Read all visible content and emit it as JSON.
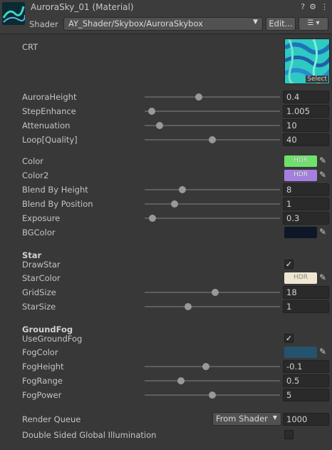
{
  "header": {
    "title": "AuroraSky_01 (Material)",
    "shader_label": "Shader",
    "shader_value": "AY_Shader/Skybox/AuroraSkybox",
    "edit_label": "Edit...",
    "list_label": "☰ ▾",
    "help_icon": "?",
    "settings_icon": "⚙",
    "more_icon": "⋮"
  },
  "props": {
    "crt": {
      "label": "CRT",
      "select_label": "Select"
    },
    "aurora_height": {
      "label": "AuroraHeight",
      "value": "0.4",
      "level": 0.4
    },
    "step_enhance": {
      "label": "StepEnhance",
      "value": "1.005",
      "level": 0.05
    },
    "attenuation": {
      "label": "Attenuation",
      "value": "10",
      "level": 0.11
    },
    "loop_quality": {
      "label": "Loop[Quality]",
      "value": "40",
      "level": 0.5
    },
    "color": {
      "label": "Color",
      "hdr": "HDR",
      "color": "#6fe06c"
    },
    "color2": {
      "label": "Color2",
      "hdr": "HDR",
      "color": "#a47fe0"
    },
    "blend_by_height": {
      "label": "Blend By Height",
      "value": "8",
      "level": 0.28
    },
    "blend_by_position": {
      "label": "Blend By Position",
      "value": "1",
      "level": 0.22
    },
    "exposure": {
      "label": "Exposure",
      "value": "0.3",
      "level": 0.06
    },
    "bg_color": {
      "label": "BGColor",
      "color": "#0d1728"
    }
  },
  "star": {
    "section": "Star",
    "draw_star": {
      "label": "DrawStar",
      "checked": "✓"
    },
    "star_color": {
      "label": "StarColor",
      "hdr": "HDR",
      "color": "#efe7d2"
    },
    "grid_size": {
      "label": "GridSize",
      "value": "18",
      "level": 0.52
    },
    "star_size": {
      "label": "StarSize",
      "value": "1",
      "level": 0.32
    }
  },
  "ground_fog": {
    "section": "GroundFog",
    "use_ground_fog": {
      "label": "UseGroundFog",
      "checked": "✓"
    },
    "fog_color": {
      "label": "FogColor",
      "color": "#25526c"
    },
    "fog_height": {
      "label": "FogHeight",
      "value": "-0.1",
      "level": 0.45
    },
    "fog_range": {
      "label": "FogRange",
      "value": "0.5",
      "level": 0.27
    },
    "fog_power": {
      "label": "FogPower",
      "value": "5",
      "level": 0.5
    }
  },
  "footer": {
    "render_queue": {
      "label": "Render Queue",
      "mode": "From Shader",
      "value": "1000"
    },
    "double_sided_gi": {
      "label": "Double Sided Global Illumination",
      "checked": ""
    }
  }
}
